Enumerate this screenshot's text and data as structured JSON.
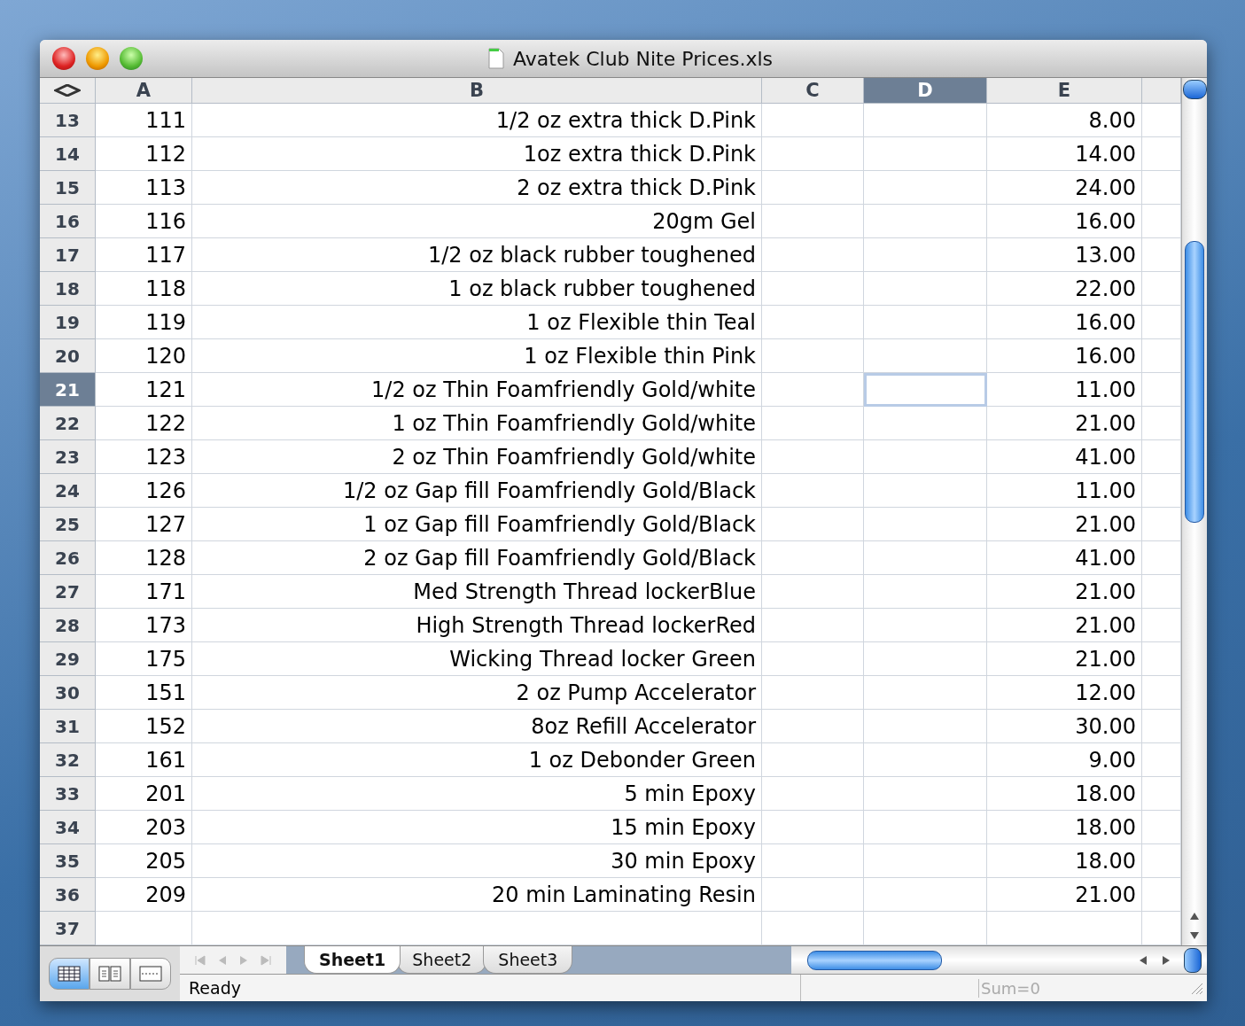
{
  "window": {
    "title": "Avatek Club Nite Prices.xls"
  },
  "columns": [
    {
      "label": "A",
      "selected": false
    },
    {
      "label": "B",
      "selected": false
    },
    {
      "label": "C",
      "selected": false
    },
    {
      "label": "D",
      "selected": true
    },
    {
      "label": "E",
      "selected": false
    }
  ],
  "rows": [
    {
      "number": "13",
      "a": "111",
      "b": "1/2 oz extra thick D.Pink",
      "e": "8.00",
      "selected": false
    },
    {
      "number": "14",
      "a": "112",
      "b": "1oz extra thick D.Pink",
      "e": "14.00",
      "selected": false
    },
    {
      "number": "15",
      "a": "113",
      "b": "2 oz extra thick D.Pink",
      "e": "24.00",
      "selected": false
    },
    {
      "number": "16",
      "a": "116",
      "b": "20gm Gel",
      "e": "16.00",
      "selected": false
    },
    {
      "number": "17",
      "a": "117",
      "b": "1/2 oz black rubber toughened",
      "e": "13.00",
      "selected": false
    },
    {
      "number": "18",
      "a": "118",
      "b": "1 oz black rubber toughened",
      "e": "22.00",
      "selected": false
    },
    {
      "number": "19",
      "a": "119",
      "b": "1 oz Flexible thin Teal",
      "e": "16.00",
      "selected": false
    },
    {
      "number": "20",
      "a": "120",
      "b": "1 oz Flexible thin Pink",
      "e": "16.00",
      "selected": false
    },
    {
      "number": "21",
      "a": "121",
      "b": "1/2 oz Thin Foamfriendly Gold/white",
      "e": "11.00",
      "selected": true
    },
    {
      "number": "22",
      "a": "122",
      "b": "1 oz Thin Foamfriendly Gold/white",
      "e": "21.00",
      "selected": false
    },
    {
      "number": "23",
      "a": "123",
      "b": "2 oz Thin Foamfriendly Gold/white",
      "e": "41.00",
      "selected": false
    },
    {
      "number": "24",
      "a": "126",
      "b": "1/2 oz Gap fill Foamfriendly Gold/Black",
      "e": "11.00",
      "selected": false
    },
    {
      "number": "25",
      "a": "127",
      "b": "1 oz Gap fill Foamfriendly Gold/Black",
      "e": "21.00",
      "selected": false
    },
    {
      "number": "26",
      "a": "128",
      "b": "2 oz Gap fill Foamfriendly Gold/Black",
      "e": "41.00",
      "selected": false
    },
    {
      "number": "27",
      "a": "171",
      "b": "Med Strength Thread lockerBlue",
      "e": "21.00",
      "selected": false
    },
    {
      "number": "28",
      "a": "173",
      "b": "High Strength Thread lockerRed",
      "e": "21.00",
      "selected": false
    },
    {
      "number": "29",
      "a": "175",
      "b": "Wicking Thread locker Green",
      "e": "21.00",
      "selected": false
    },
    {
      "number": "30",
      "a": "151",
      "b": "2 oz Pump Accelerator",
      "e": "12.00",
      "selected": false
    },
    {
      "number": "31",
      "a": "152",
      "b": "8oz Refill Accelerator",
      "e": "30.00",
      "selected": false
    },
    {
      "number": "32",
      "a": "161",
      "b": "1 oz Debonder Green",
      "e": "9.00",
      "selected": false
    },
    {
      "number": "33",
      "a": "201",
      "b": "5 min Epoxy",
      "e": "18.00",
      "selected": false
    },
    {
      "number": "34",
      "a": "203",
      "b": "15 min Epoxy",
      "e": "18.00",
      "selected": false
    },
    {
      "number": "35",
      "a": "205",
      "b": "30 min Epoxy",
      "e": "18.00",
      "selected": false
    },
    {
      "number": "36",
      "a": "209",
      "b": "20 min Laminating Resin",
      "e": "21.00",
      "selected": false
    },
    {
      "number": "37",
      "selected": false
    }
  ],
  "view_buttons": [
    {
      "kind": "normal",
      "selected": true
    },
    {
      "kind": "layout",
      "selected": false
    },
    {
      "kind": "page-break",
      "selected": false
    }
  ],
  "sheet_tabs": [
    {
      "label": "Sheet1",
      "selected": true
    },
    {
      "label": "Sheet2",
      "selected": false
    },
    {
      "label": "Sheet3",
      "selected": false
    }
  ],
  "status_bar": {
    "status": "Ready",
    "sum": "Sum=0"
  }
}
